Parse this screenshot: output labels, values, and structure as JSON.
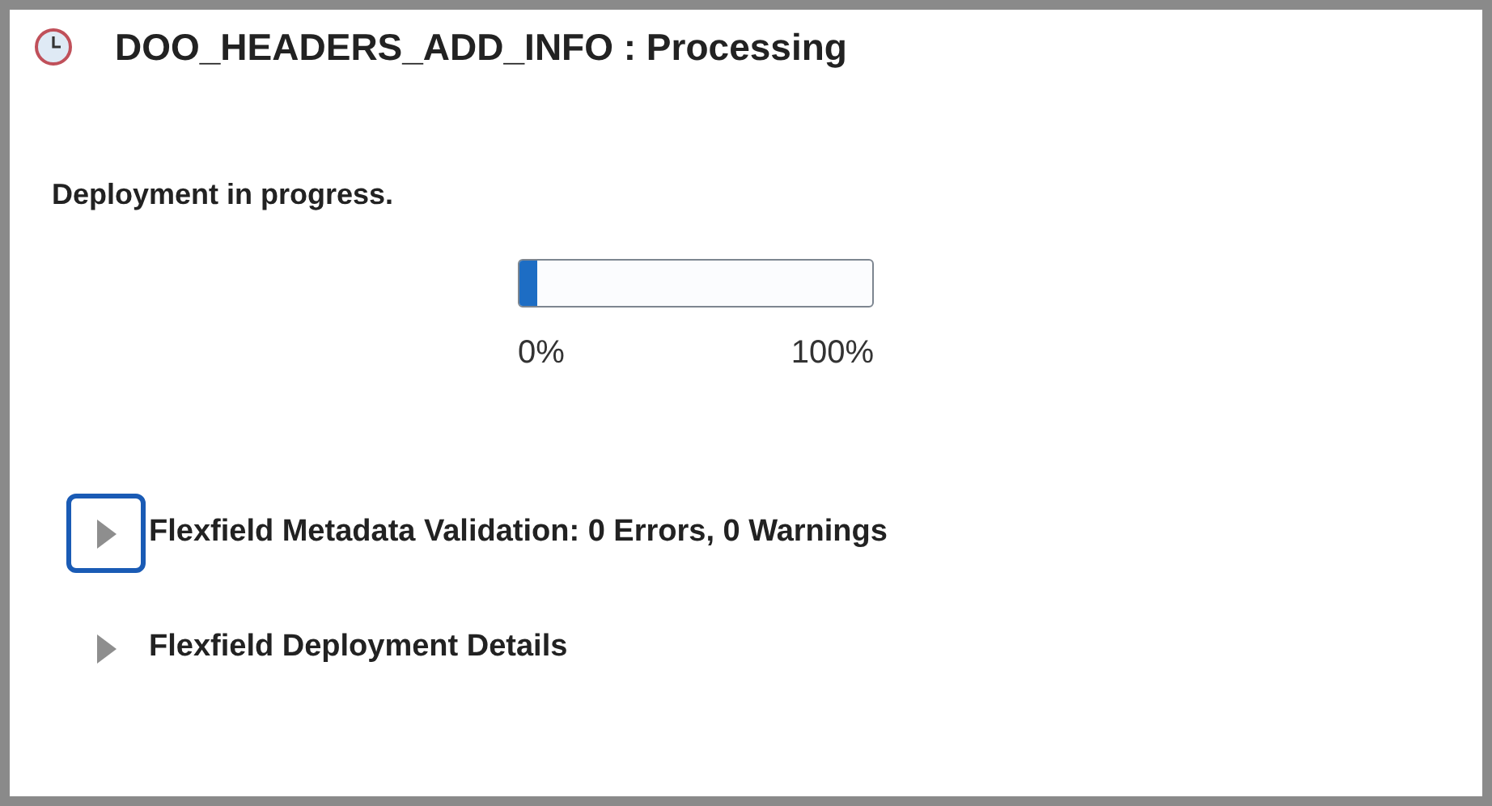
{
  "window": {
    "title": "DOO_HEADERS_ADD_INFO : Processing"
  },
  "status": "Deployment in progress.",
  "progress": {
    "level": 0.05,
    "min_label": "0%",
    "max_label": "100%"
  },
  "sections": [
    {
      "title": "Flexfield Metadata Validation: 0 Errors, 0 Warnings",
      "expanded": false,
      "focused": true
    },
    {
      "title": "Flexfield Deployment Details",
      "expanded": false,
      "focused": false
    }
  ]
}
